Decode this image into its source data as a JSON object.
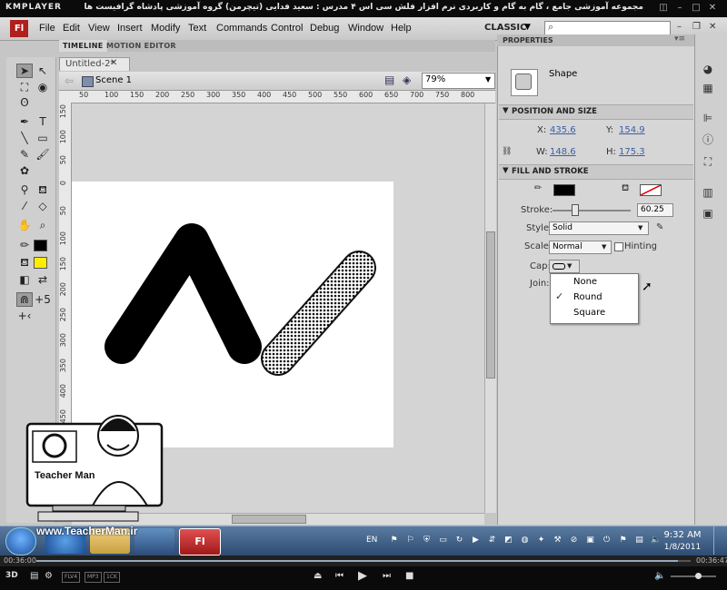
{
  "player": {
    "logo": "KMPLAYER",
    "title": "مجموعه آموزشی جامع ، گام به گام و کاربردی نرم افزار فلش سی اس ۴ مدرس : سعید فدایی (تیچرمن) گروه آموزشی پادشاه گرافیست ها",
    "time_elapsed": "00:36:00",
    "time_total": "00:36:47",
    "badges": [
      "FLV4",
      "MP3",
      "1CK"
    ],
    "progress_fraction": 0.98,
    "volume_fraction": 0.6
  },
  "app": {
    "logo": "Fl",
    "menus": [
      "File",
      "Edit",
      "View",
      "Insert",
      "Modify",
      "Text",
      "Commands",
      "Control",
      "Debug",
      "Window",
      "Help"
    ],
    "workspace": "CLASSIC",
    "panel_tabs": [
      "TIMELINE",
      "MOTION EDITOR"
    ],
    "document_tab": "Untitled-2*",
    "scene": "Scene 1",
    "zoom": "79%",
    "ruler_top": [
      "50",
      "100",
      "150",
      "200",
      "250",
      "300",
      "350",
      "400",
      "450",
      "500",
      "550",
      "600",
      "650",
      "700",
      "750",
      "800"
    ],
    "ruler_left": [
      "150",
      "100",
      "50",
      "0",
      "50",
      "100",
      "150",
      "200",
      "250",
      "300",
      "350",
      "400",
      "450"
    ]
  },
  "properties": {
    "title": "PROPERTIES",
    "object_type": "Shape",
    "section_position": "POSITION AND SIZE",
    "x_label": "X:",
    "x_value": "435.6",
    "y_label": "Y:",
    "y_value": "154.9",
    "w_label": "W:",
    "w_value": "148.6",
    "h_label": "H:",
    "h_value": "175.3",
    "section_fill": "FILL AND STROKE",
    "stroke_label": "Stroke:",
    "stroke_value": "60.25",
    "style_label": "Style:",
    "style_value": "Solid",
    "scale_label": "Scale:",
    "scale_value": "Normal",
    "hinting_label": "Hinting",
    "cap_label": "Cap:",
    "join_label": "Join:",
    "cap_options": [
      "None",
      "Round",
      "Square"
    ],
    "cap_selected": "Round",
    "colors": {
      "stroke": "#000000",
      "fill": "none"
    }
  },
  "taskbar": {
    "lang": "EN",
    "time": "9:32 AM",
    "date": "1/8/2011"
  },
  "watermark": {
    "brand": "Teacher Man",
    "url": "www.TeacherMan.ir"
  }
}
